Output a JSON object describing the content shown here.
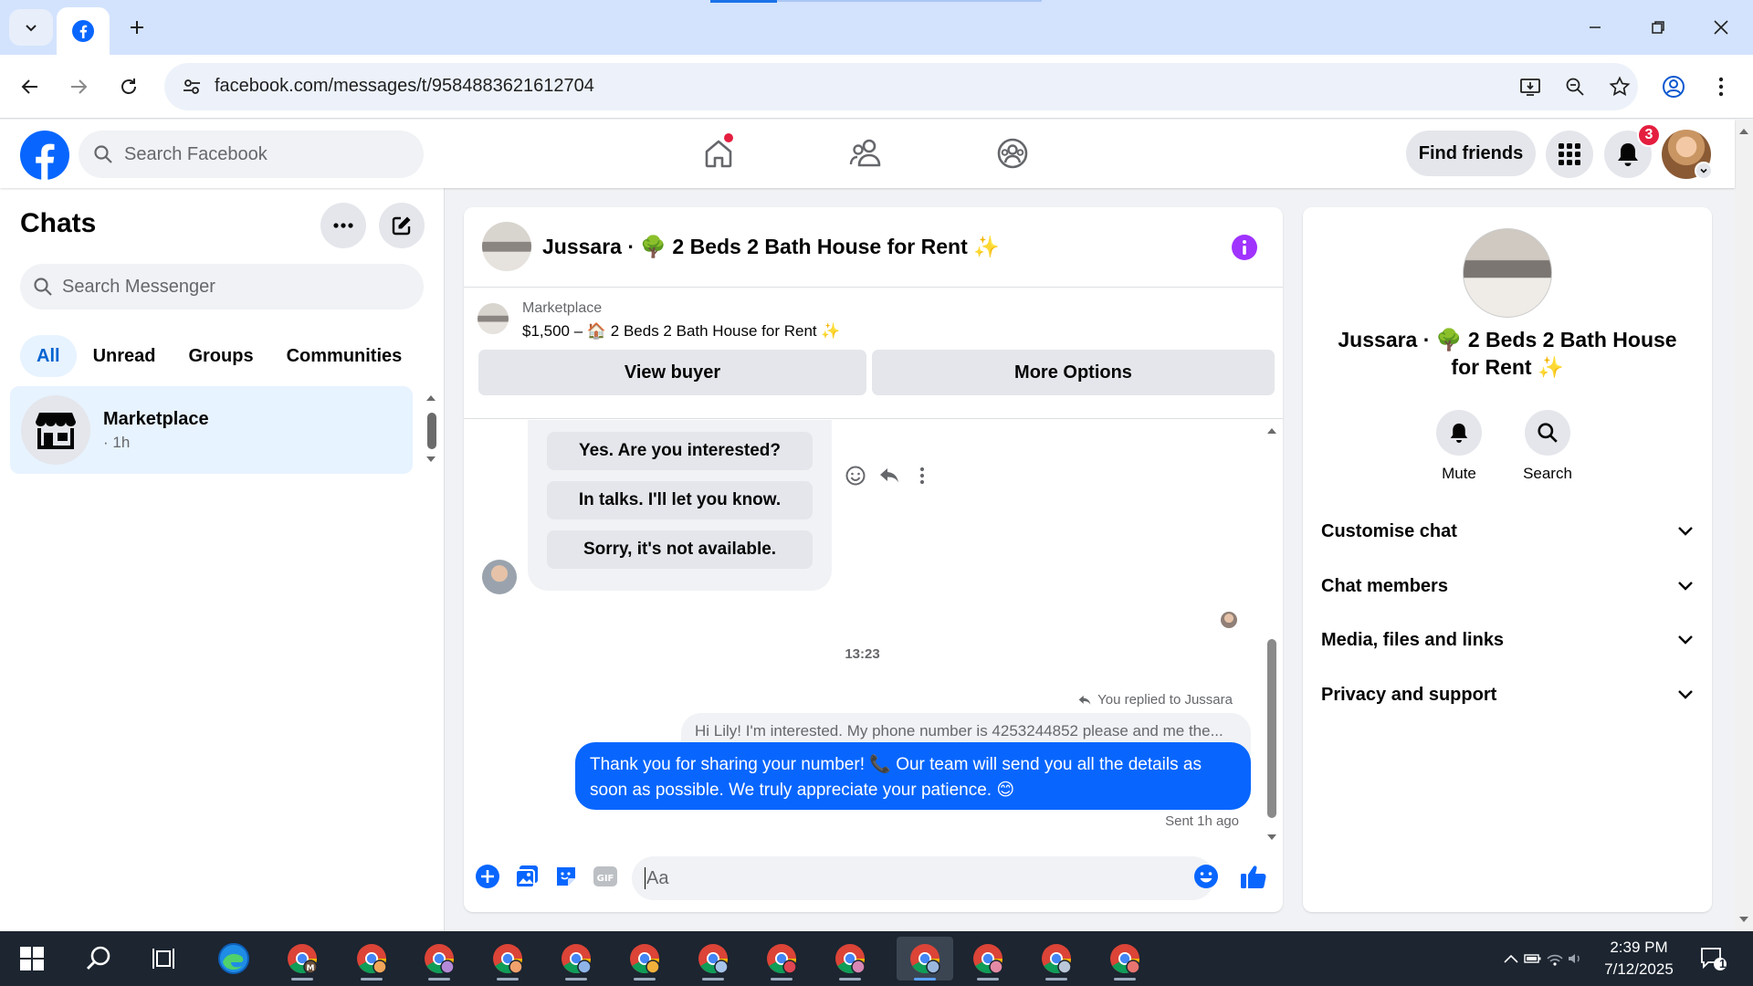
{
  "browser": {
    "url": "facebook.com/messages/t/9584883621612704"
  },
  "fb": {
    "search_placeholder": "Search Facebook",
    "find_friends": "Find friends",
    "notifications_count": "3",
    "brand_color": "#0866ff"
  },
  "chats": {
    "title": "Chats",
    "search_placeholder": "Search Messenger",
    "filters": [
      "All",
      "Unread",
      "Groups",
      "Communities"
    ],
    "items": [
      {
        "name": "Marketplace",
        "time": "· 1h"
      }
    ]
  },
  "conversation": {
    "title": "Jussara · 🌳 2 Beds 2 Bath House for Rent ✨",
    "listing_source": "Marketplace",
    "listing_line": "$1,500 – 🏠 2 Beds 2 Bath House for Rent ✨",
    "view_buyer": "View buyer",
    "more_options": "More Options",
    "quick_replies": [
      "Yes. Are you interested?",
      "In talks. I'll let you know.",
      "Sorry, it's not available."
    ],
    "timestamp": "13:23",
    "replied_label": "You replied to Jussara",
    "quoted_text": "Hi Lily! I'm interested. My phone number is 4253244852 please and me the...",
    "outgoing_message": "Thank you for sharing your number! 📞 Our team will send you all the details as soon as possible. We truly appreciate your patience. 😊",
    "sent_status": "Sent 1h ago",
    "composer_placeholder": "Aa"
  },
  "info_panel": {
    "name": "Jussara · 🌳 2 Beds 2 Bath House for Rent ✨",
    "mute_label": "Mute",
    "search_label": "Search",
    "sections": [
      "Customise chat",
      "Chat members",
      "Media, files and links",
      "Privacy and support"
    ]
  },
  "taskbar": {
    "time": "2:39 PM",
    "date": "7/12/2025",
    "notification_count": "1"
  }
}
